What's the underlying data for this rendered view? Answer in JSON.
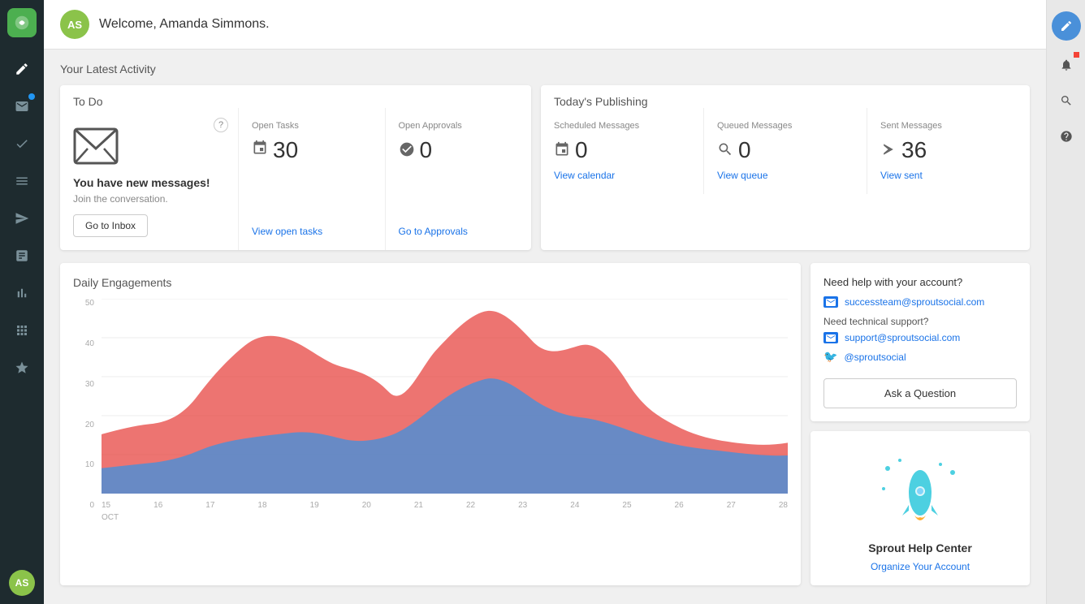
{
  "header": {
    "welcome_text": "Welcome, Amanda Simmons.",
    "avatar_initials": "AS"
  },
  "sidebar": {
    "logo_label": "Sprout Social",
    "items": [
      {
        "id": "compose",
        "icon": "✏",
        "label": "Compose",
        "active": false
      },
      {
        "id": "inbox",
        "icon": "✉",
        "label": "Inbox",
        "active": true,
        "badge": "red"
      },
      {
        "id": "tasks",
        "icon": "☑",
        "label": "Tasks",
        "active": false
      },
      {
        "id": "publishing",
        "icon": "≡",
        "label": "Publishing",
        "active": false
      },
      {
        "id": "send",
        "icon": "➤",
        "label": "Send",
        "active": false
      },
      {
        "id": "analytics",
        "icon": "▦",
        "label": "Analytics",
        "active": false
      },
      {
        "id": "reports",
        "icon": "📊",
        "label": "Reports",
        "active": false
      },
      {
        "id": "apps",
        "icon": "⊞",
        "label": "Apps",
        "active": false
      },
      {
        "id": "star",
        "icon": "★",
        "label": "Favorites",
        "active": false
      }
    ]
  },
  "action_bar": {
    "compose_label": "Compose",
    "notifications_label": "Notifications",
    "search_label": "Search",
    "help_label": "Help"
  },
  "activity": {
    "section_title": "Your Latest Activity",
    "todo": {
      "card_title": "To Do",
      "inbox": {
        "title": "You have new messages!",
        "subtitle": "Join the conversation.",
        "button_label": "Go to Inbox"
      },
      "open_tasks": {
        "label": "Open Tasks",
        "value": "30",
        "link": "View open tasks"
      },
      "open_approvals": {
        "label": "Open Approvals",
        "value": "0",
        "link": "Go to Approvals"
      }
    },
    "publishing": {
      "card_title": "Today's Publishing",
      "scheduled": {
        "label": "Scheduled Messages",
        "value": "0",
        "link": "View calendar"
      },
      "queued": {
        "label": "Queued Messages",
        "value": "0",
        "link": "View queue"
      },
      "sent": {
        "label": "Sent Messages",
        "value": "36",
        "link": "View sent"
      }
    }
  },
  "chart": {
    "title": "Daily Engagements",
    "y_labels": [
      "0",
      "10",
      "20",
      "30",
      "40",
      "50"
    ],
    "x_labels": [
      "15",
      "16",
      "17",
      "18",
      "19",
      "20",
      "21",
      "22",
      "23",
      "24",
      "25",
      "26",
      "27",
      "28"
    ],
    "x_sub_label": "OCT"
  },
  "help": {
    "account_help_title": "Need help with your account?",
    "success_email": "successteam@sproutsocial.com",
    "technical_support_title": "Need technical support?",
    "support_email": "support@sproutsocial.com",
    "twitter_handle": "@sproutsocial",
    "ask_button_label": "Ask a Question",
    "help_center_title": "Sprout Help Center",
    "help_center_link": "Organize Your Account"
  }
}
